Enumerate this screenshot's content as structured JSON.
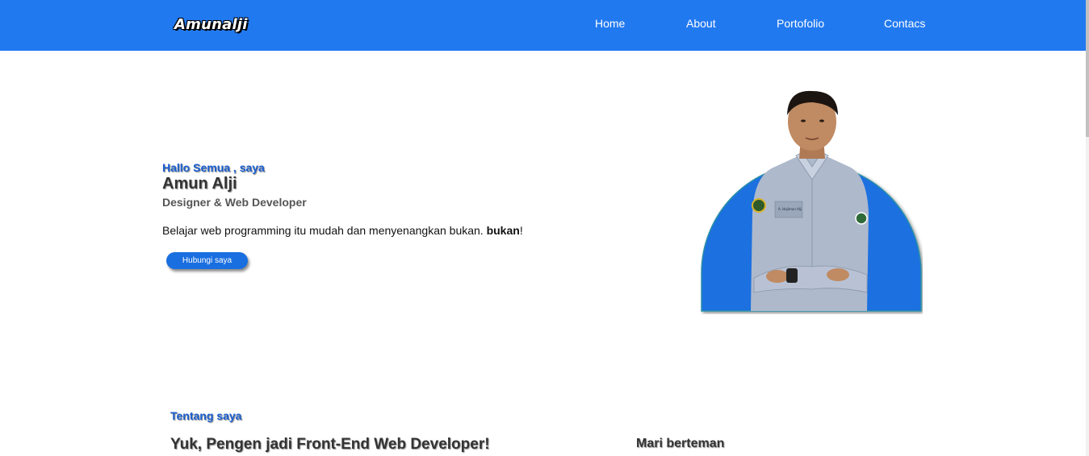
{
  "navbar": {
    "logo": "Amunalji",
    "links": [
      {
        "label": "Home"
      },
      {
        "label": "About"
      },
      {
        "label": "Portofolio"
      },
      {
        "label": "Contacs"
      }
    ]
  },
  "hero": {
    "greeting": "Hallo Semua , saya",
    "name": "Amun Alji",
    "role": "Designer & Web Developer",
    "description_prefix": "Belajar web programming itu mudah dan menyenangkan bukan. ",
    "description_bold": "bukan",
    "description_suffix": "!",
    "button_label": "Hubungi saya",
    "photo_badge_text": "A. Hajimun Alji"
  },
  "about": {
    "kicker": "Tentang saya",
    "title": "Yuk, Pengen jadi Front-End Web Developer!",
    "side_title": "Mari berteman"
  },
  "colors": {
    "brand": "#2179f0",
    "accent": "#1a5fd0",
    "photo_backdrop": "#1a6fe0"
  }
}
